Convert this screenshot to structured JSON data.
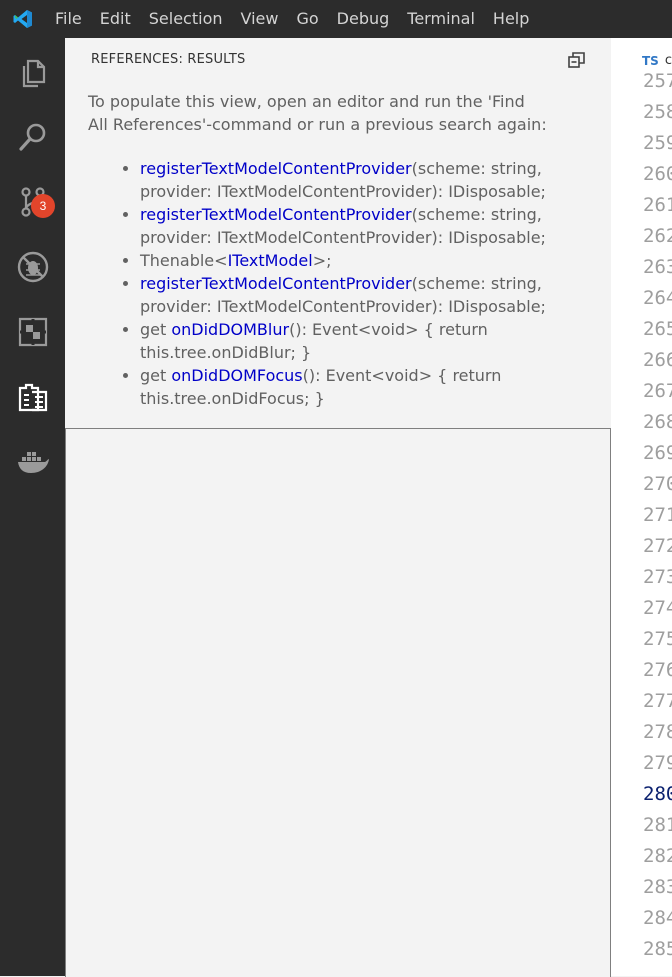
{
  "menu": {
    "items": [
      "File",
      "Edit",
      "Selection",
      "View",
      "Go",
      "Debug",
      "Terminal",
      "Help"
    ]
  },
  "activity_bar": {
    "items": [
      {
        "name": "explorer",
        "icon": "files-icon"
      },
      {
        "name": "search",
        "icon": "search-icon"
      },
      {
        "name": "source-control",
        "icon": "source-control-icon",
        "badge": "3"
      },
      {
        "name": "debug",
        "icon": "debug-icon"
      },
      {
        "name": "extensions",
        "icon": "extensions-icon"
      },
      {
        "name": "references",
        "icon": "references-icon"
      },
      {
        "name": "docker",
        "icon": "docker-icon"
      }
    ]
  },
  "panel": {
    "title": "REFERENCES: RESULTS",
    "message": "To populate this view, open an editor and run the 'Find All References'-command or run a previous search again:",
    "results": [
      {
        "prefix": "",
        "symbol": "registerTextModelContentProvider",
        "suffix": "(scheme: string, provider: ITextModelContentProvider): IDisposable;"
      },
      {
        "prefix": "",
        "symbol": "registerTextModelContentProvider",
        "suffix": "(scheme: string, provider: ITextModelContentProvider): IDisposable;"
      },
      {
        "prefix": "Thenable<",
        "symbol": "ITextModel",
        "suffix": ">;"
      },
      {
        "prefix": "",
        "symbol": "registerTextModelContentProvider",
        "suffix": "(scheme: string, provider: ITextModelContentProvider): IDisposable;"
      },
      {
        "prefix": "get ",
        "symbol": "onDidDOMBlur",
        "suffix": "(): Event<void> { return this.tree.onDidBlur; }"
      },
      {
        "prefix": "get ",
        "symbol": "onDidDOMFocus",
        "suffix": "(): Event<void> { return this.tree.onDidFocus; }"
      }
    ]
  },
  "editor": {
    "tab": {
      "icon_label": "TS",
      "label": "c"
    },
    "line_numbers": [
      "257",
      "258",
      "259",
      "260",
      "261",
      "262",
      "263",
      "264",
      "265",
      "266",
      "267",
      "268",
      "269",
      "270",
      "271",
      "272",
      "273",
      "274",
      "275",
      "276",
      "277",
      "278",
      "279",
      "280",
      "281",
      "282",
      "283",
      "284",
      "285"
    ],
    "current_line": "280"
  },
  "colors": {
    "titlebar": "#2c2c2c",
    "sidebar": "#f3f3f3",
    "link": "#0000c8",
    "badge": "#e2452b",
    "accent": "#3178c6"
  }
}
